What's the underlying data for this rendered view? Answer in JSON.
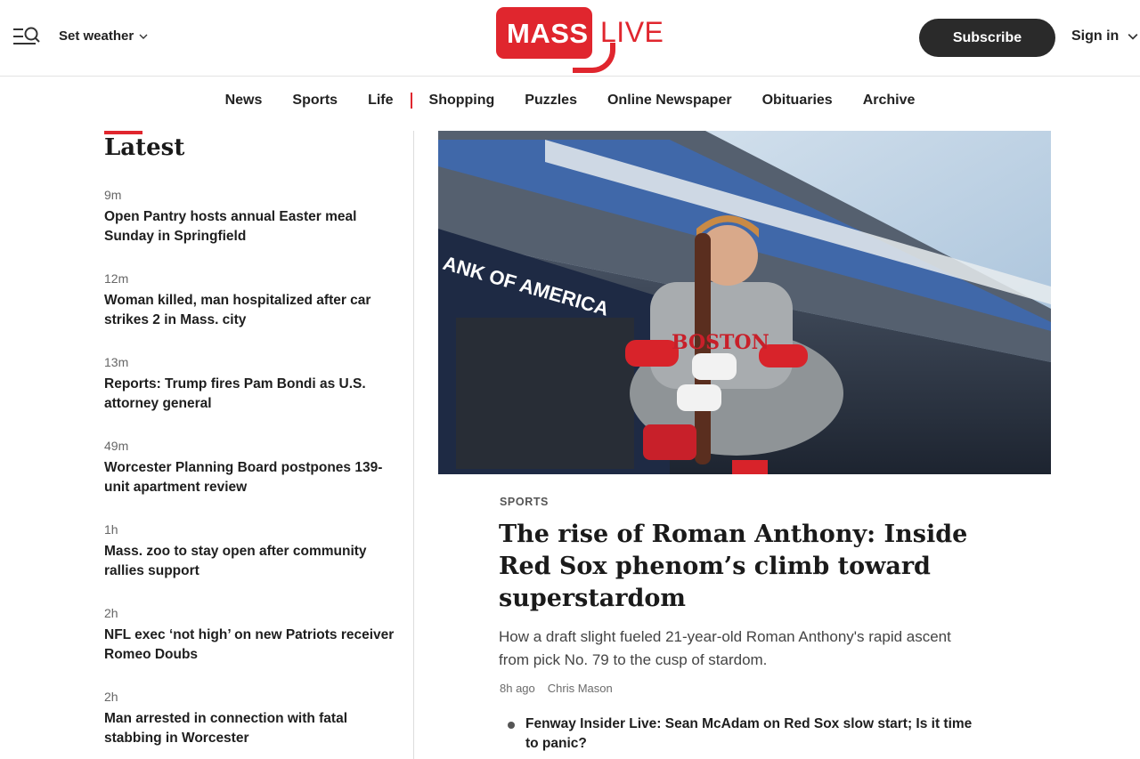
{
  "header": {
    "weather_label": "Set weather",
    "logo": {
      "mass": "MASS",
      "live": "LIVE"
    },
    "subscribe_label": "Subscribe",
    "signin_label": "Sign in"
  },
  "nav": {
    "items": [
      "News",
      "Sports",
      "Life",
      "Shopping",
      "Puzzles",
      "Online Newspaper",
      "Obituaries",
      "Archive"
    ]
  },
  "latest": {
    "title": "Latest",
    "items": [
      {
        "time": "9m",
        "headline": "Open Pantry hosts annual Easter meal Sunday in Springfield"
      },
      {
        "time": "12m",
        "headline": "Woman killed, man hospitalized after car strikes 2 in Mass. city"
      },
      {
        "time": "13m",
        "headline": "Reports: Trump fires Pam Bondi as U.S. attorney general"
      },
      {
        "time": "49m",
        "headline": "Worcester Planning Board postpones 139-unit apartment review"
      },
      {
        "time": "1h",
        "headline": "Mass. zoo to stay open after community rallies support"
      },
      {
        "time": "2h",
        "headline": "NFL exec ‘not high’ on new Patriots receiver Romeo Doubs"
      },
      {
        "time": "2h",
        "headline": "Man arrested in connection with fatal stabbing in Worcester"
      }
    ]
  },
  "feature": {
    "image_text": {
      "stadium_banner": "ANK OF AMERICA",
      "jersey": "BOSTON"
    },
    "kicker": "SPORTS",
    "headline": "The rise of Roman Anthony: Inside Red Sox phenom’s climb toward superstardom",
    "dek": "How a draft slight fueled 21-year-old Roman Anthony's rapid ascent from pick No. 79 to the cusp of stardom.",
    "time": "8h ago",
    "author": "Chris Mason",
    "related": "Fenway Insider Live: Sean McAdam on Red Sox slow start; Is it time to panic?"
  },
  "colors": {
    "brand_red": "#e0262e",
    "button_dark": "#2a2a2a"
  }
}
